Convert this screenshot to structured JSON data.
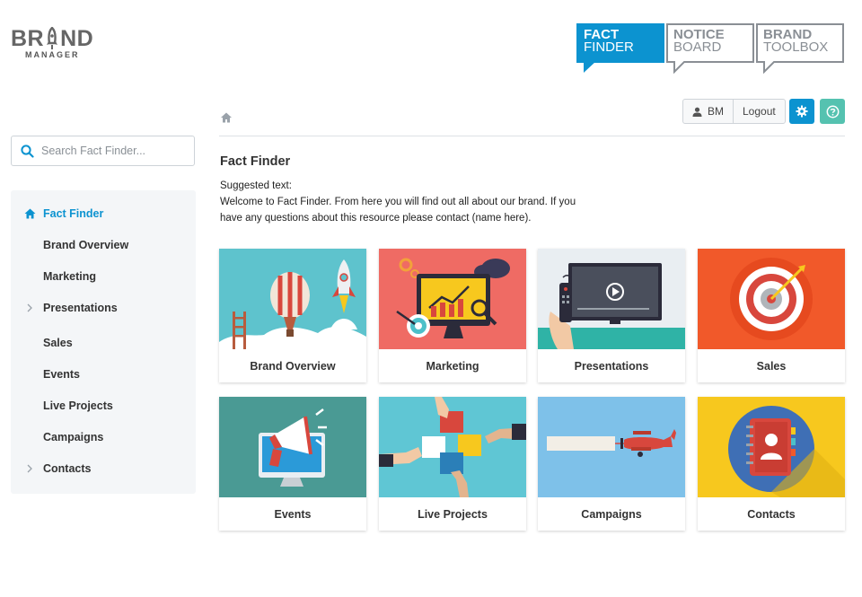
{
  "logo": {
    "word_left": "BR",
    "word_right": "ND",
    "sub": "MANAGER"
  },
  "top_tabs": [
    {
      "line1": "FACT",
      "line2": "FINDER",
      "active": true
    },
    {
      "line1": "NOTICE",
      "line2": "BOARD",
      "active": false
    },
    {
      "line1": "BRAND",
      "line2": "TOOLBOX",
      "active": false
    }
  ],
  "toolbar": {
    "user_label": "BM",
    "logout_label": "Logout"
  },
  "search": {
    "placeholder": "Search Fact Finder..."
  },
  "nav": {
    "items": [
      {
        "label": "Fact Finder",
        "active": true
      },
      {
        "label": "Brand Overview"
      },
      {
        "label": "Marketing"
      },
      {
        "label": "Presentations",
        "expandable": true
      },
      {
        "label": "Sales"
      },
      {
        "label": "Events"
      },
      {
        "label": "Live Projects"
      },
      {
        "label": "Campaigns"
      },
      {
        "label": "Contacts",
        "expandable": true
      }
    ]
  },
  "main": {
    "title": "Fact Finder",
    "suggested_label": "Suggested text:",
    "suggested_body": "Welcome to Fact Finder. From here you will find out all about our brand. If you have any questions about this resource please contact (name here)."
  },
  "cards": [
    {
      "label": "Brand Overview",
      "bg": "#5ec3cd"
    },
    {
      "label": "Marketing",
      "bg": "#ef6b64"
    },
    {
      "label": "Presentations",
      "bg": "#4cc0c9"
    },
    {
      "label": "Sales",
      "bg": "#f1592a"
    },
    {
      "label": "Events",
      "bg": "#4a9a94"
    },
    {
      "label": "Live Projects",
      "bg": "#5fc6d4"
    },
    {
      "label": "Campaigns",
      "bg": "#7ec1e9"
    },
    {
      "label": "Contacts",
      "bg": "#f7c81e"
    }
  ],
  "colors": {
    "accent": "#0c93d0",
    "help": "#55c2b0",
    "tab_border": "#8a8f95"
  }
}
